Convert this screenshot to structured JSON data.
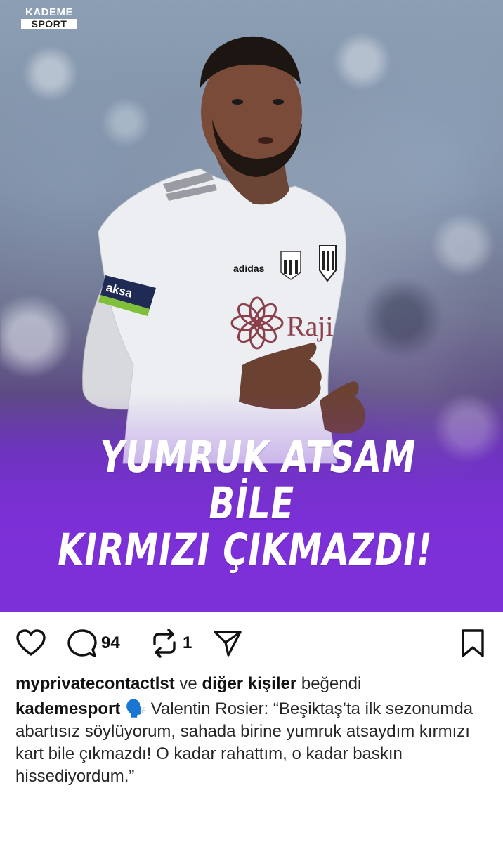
{
  "post": {
    "logo_top": "KADEME",
    "logo_bottom": "SPORT",
    "headline_line1": "YUMRUK ATSAM BİLE",
    "headline_line2": "KIRMIZI ÇIKMAZDI!",
    "jersey_sponsor_sleeve": "aksa",
    "jersey_brand": "adidas",
    "jersey_sponsor_chest": "Raji"
  },
  "actions": {
    "comment_count": "94",
    "repost_count": "1"
  },
  "likes": {
    "user": "myprivatecontactlst",
    "connector": "ve",
    "others": "diğer kişiler",
    "verb": "beğendi"
  },
  "caption": {
    "username": "kademesport",
    "emoji": "🗣️",
    "text": "Valentin Rosier: “Beşiktaş’ta ilk sezonumda abartısız söylüyorum, sahada birine yumruk atsaydım kırmızı kart bile çıkmazdı! O kadar rahattım, o kadar baskın hissediyordum.”"
  },
  "colors": {
    "purple_gradient": "#7b2fd6",
    "text": "#262626",
    "icon": "#111111"
  }
}
